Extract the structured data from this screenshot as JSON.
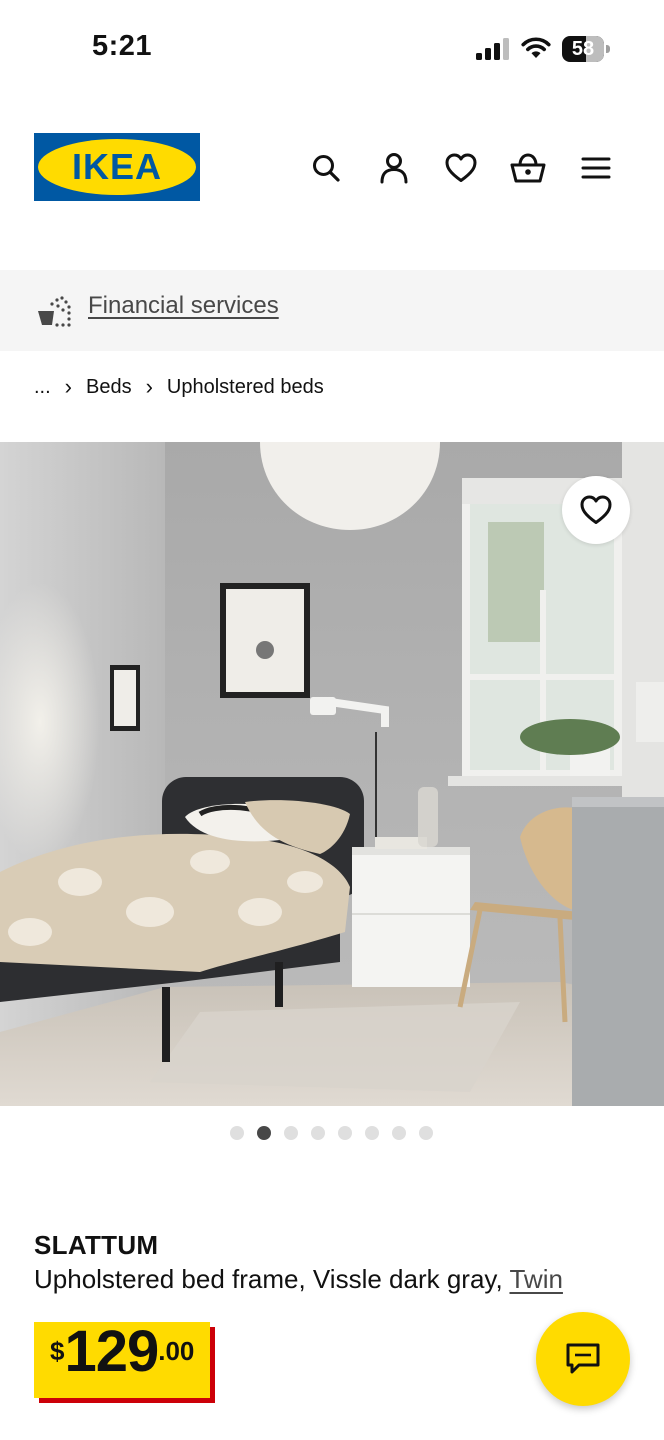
{
  "status_bar": {
    "time": "5:21",
    "battery": 58,
    "battery_label": "58",
    "icons": [
      "signal-icon",
      "wifi-icon",
      "battery-icon"
    ]
  },
  "header": {
    "logo_text": "IKEA",
    "icons": [
      "search-icon",
      "account-icon",
      "heart-icon",
      "cart-icon",
      "menu-icon"
    ]
  },
  "financial_banner": {
    "icon": "financial-services-icon",
    "label": "Financial services"
  },
  "breadcrumb": {
    "items": [
      "...",
      "Beds",
      "Upholstered beds"
    ],
    "separator": "›"
  },
  "gallery": {
    "total_images": 8,
    "active_index": 2
  },
  "product": {
    "name": "SLATTUM",
    "description": "Upholstered bed frame, Vissle dark gray, ",
    "size_link": "Twin",
    "price": {
      "currency": "$",
      "integer": "129",
      "decimal": ".00"
    }
  },
  "colors": {
    "brand_blue": "#0058a3",
    "brand_yellow": "#ffdb00",
    "price_shadow_red": "#cc0008",
    "banner_bg": "#f5f5f5",
    "dot_active": "#484848",
    "dot_inactive": "#dfdfdf"
  }
}
